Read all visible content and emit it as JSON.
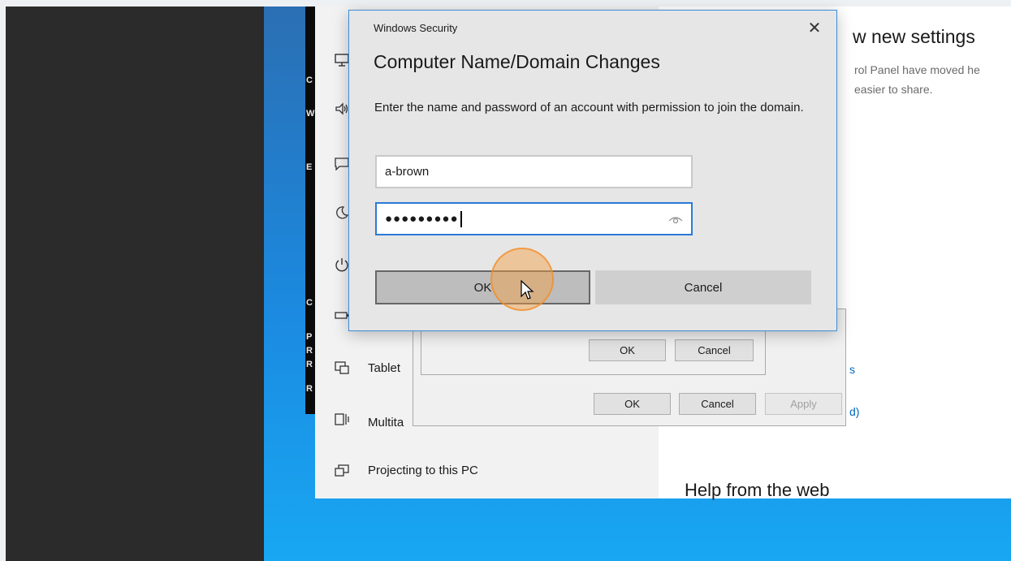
{
  "background": {
    "edge_letters": [
      "C",
      "W",
      "E",
      "C",
      "P",
      "R",
      "R",
      "R"
    ]
  },
  "settings": {
    "sidebar_items": [
      {
        "label": "",
        "icon": "monitor-icon"
      },
      {
        "label": "",
        "icon": "speaker-icon"
      },
      {
        "label": "",
        "icon": "notifications-icon"
      },
      {
        "label": "",
        "icon": "moon-icon"
      },
      {
        "label": "",
        "icon": "power-icon"
      },
      {
        "label": "",
        "icon": "battery-icon"
      },
      {
        "label": "Tablet",
        "icon": "tablet-icon"
      },
      {
        "label": "Multita",
        "icon": "multitasking-icon"
      },
      {
        "label": "Projecting to this PC",
        "icon": "projecting-icon"
      }
    ],
    "right_heading": "w new settings",
    "right_text_1": "rol Panel have moved he",
    "right_text_2": "easier to share.",
    "right_link_1": "s",
    "right_link_2": "d)",
    "help_heading": "Help from the web"
  },
  "system_properties": {
    "ok": "OK",
    "cancel": "Cancel",
    "apply": "Apply"
  },
  "computer_name_changes": {
    "ok": "OK",
    "cancel": "Cancel"
  },
  "security_dialog": {
    "caption": "Windows Security",
    "close_glyph": "✕",
    "title": "Computer Name/Domain Changes",
    "message": "Enter the name and password of an account with permission to join the domain.",
    "username_value": "a-brown",
    "password_mask": "●●●●●●●●●",
    "ok_label": "OK",
    "cancel_label": "Cancel"
  },
  "colors": {
    "accent": "#2b7ad6",
    "click_highlight": "#f79d40",
    "link": "#0067c0"
  }
}
